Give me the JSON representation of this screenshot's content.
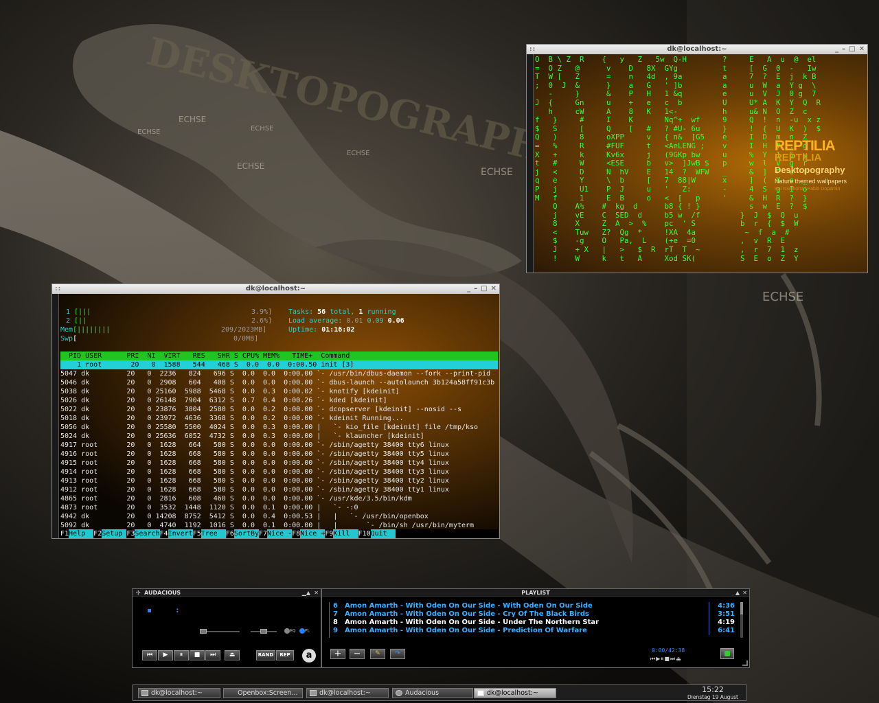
{
  "colors": {
    "term_green": "#36ff3a",
    "htop_cyan": "#2ad0d0",
    "htop_header": "#21c521",
    "playlist_blue": "#3ab0ff",
    "accent_orange": "#ffb21f"
  },
  "wallpaper": {
    "words": [
      "ECHSE",
      "ECHSE",
      "ECHSE",
      "ECHSE",
      "ECHSE",
      "ECHSE",
      "ECHSE"
    ],
    "title_art": "DESKTOPOGRAPHY"
  },
  "matrix_window": {
    "title": "dk@localhost:~",
    "lines": [
      "O  B \\ Z  R    {   y   Z   5w  Q-H        ?     E   A  u  @  el",
      "=  O Z   @      v    D   8X  GYg          t     [  G  0  -   Iw",
      "T  W [   Z      =    n   4d  , 9a         a     7  ?  E  j  k B",
      ";  0  J  &      }    a   G   ' ]b         a     u  W  a  Y g  \\",
      "   -     }      &    P   H   1 &q         e     u  V  J  0 g  7",
      "J  {     Gn     u    +   e   c  b         U     U* A  K  Y  Q  R",
      "   h     cW     A    8   K   1<-          h     u& N  O  Z  c",
      "f   }     #     I    K       Nq^+  wf     9     Q  !  n  -u  x z",
      "$   S     [     Q    [   #   ? #U- 6u     }     !  {  U  K  )  $",
      "Q   )     8     oXPP     v   { n&  [G5    e     I  D  m  n  Z",
      "=   %     R     #FUF     t   <AeLENG ;    v     I  H  #  :  g",
      "X   +     k     Kv6x     j   (9GKp bw     u     %  Y  1  6  y",
      "t   #     W     <ESE     b   v>  ]JwB $   p     w  l  V  g  r",
      "j   <     D     N  hV    E   14  ?  WFW   _     &  ]  P  u  f",
      "q   e     Y     \\  b     [   7  88|W      x     ]  (  X  o  _",
      "P   j     U1    P  J     u   '   Z:       -     4  S  g  I  o",
      "M   f     1     E  B     o   <  [   p     '     &  H  R  ?  }",
      "    Q    A%    #  kg  d      b8 { ! }           s  w  E  ?  $",
      "    j    vE    C  SED  d     b5 w  /f         }  J  $  Q  u",
      "    8    X     Z  A  >  %    pc  ' S          b  r  {  $  W",
      "    <    Tuw   Z?  Qg  *     !XA  4a           ~  f  a  #",
      "    $    -g    O   Pa,  L    (+e  =0          ,  v  R  E",
      "    J    + X   |   >   $  R  rT  T  ~         ,  r  7  1  z",
      "    !    W     k   t   A     Xod SK(          S  E  o  Z  Y"
    ],
    "logo": {
      "title": "REPTILIA",
      "sub": "REPTILIA",
      "brand": "Desktopography",
      "tagline": "Nature themed wallpapers",
      "credit": "Kai Isselhorst / Fabio Dopamin"
    }
  },
  "htop_window": {
    "title": "dk@localhost:~",
    "cpu1": {
      "label": "1",
      "bar": "[|||",
      "value": "3.9%]"
    },
    "cpu2": {
      "label": "2",
      "bar": "[||",
      "value": "2.6%]"
    },
    "mem": {
      "label": "Mem",
      "bar": "[||||||||",
      "value": "209/2023MB]"
    },
    "swp": {
      "label": "Swp",
      "bar": "[",
      "value": "0/0MB]"
    },
    "tasks": {
      "label": "Tasks:",
      "total": "56",
      "total_suffix": "total,",
      "running": "1",
      "running_suffix": "running"
    },
    "load": {
      "label": "Load average:",
      "v1": "0.01",
      "v2": "0.09",
      "v3": "0.06"
    },
    "uptime": {
      "label": "Uptime:",
      "value": "01:16:02"
    },
    "header": "  PID USER      PRI  NI  VIRT   RES   SHR S CPU% MEM%   TIME+  Command",
    "selected_row": "    1 root       20   0  1588   544   468 S  0.0  0.0  0:00.50 init [3]",
    "rows": [
      "5047 dk         20   0  2236   824   696 S  0.0  0.0  0:00.00 `- /usr/bin/dbus-daemon --fork --print-pid",
      "5046 dk         20   0  2908   604   408 S  0.0  0.0  0:00.00 `- dbus-launch --autolaunch 3b124a58ff91c3b",
      "5038 dk         20   0 25160  5988  5468 S  0.0  0.3  0:00.02 `- knotify [kdeinit]",
      "5026 dk         20   0 26148  7904  6312 S  0.7  0.4  0:00.26 `- kded [kdeinit]",
      "5022 dk         20   0 23876  3804  2580 S  0.0  0.2  0:00.00 `- dcopserver [kdeinit] --nosid --s",
      "5018 dk         20   0 23972  4636  3368 S  0.0  0.2  0:00.00 `- kdeinit Running...",
      "5056 dk         20   0 25580  5500  4024 S  0.0  0.3  0:00.00 |   `- kio_file [kdeinit] file /tmp/kso",
      "5024 dk         20   0 25636  6052  4732 S  0.0  0.3  0:00.00 |   `- klauncher [kdeinit]",
      "4917 root       20   0  1628   664   580 S  0.0  0.0  0:00.00 `- /sbin/agetty 38400 tty6 linux",
      "4916 root       20   0  1628   668   580 S  0.0  0.0  0:00.00 `- /sbin/agetty 38400 tty5 linux",
      "4915 root       20   0  1628   668   580 S  0.0  0.0  0:00.00 `- /sbin/agetty 38400 tty4 linux",
      "4914 root       20   0  1628   668   580 S  0.0  0.0  0:00.00 `- /sbin/agetty 38400 tty3 linux",
      "4913 root       20   0  1628   668   580 S  0.0  0.0  0:00.00 `- /sbin/agetty 38400 tty2 linux",
      "4912 root       20   0  1628   668   580 S  0.0  0.0  0:00.00 `- /sbin/agetty 38400 tty1 linux",
      "4865 root       20   0  2816   608   460 S  0.0  0.0  0:00.00 `- /usr/kde/3.5/bin/kdm",
      "4873 root       20   0  3532  1448  1120 S  0.0  0.1  0:00.00 |   `- -:0",
      "4942 dk         20   0 14208  8752  5412 S  0.0  0.4  0:00.53 |   |   `- /usr/bin/openbox",
      "5092 dk         20   0  4740  1192  1016 S  0.0  0.1  0:00.00 |   |       `- /bin/sh /usr/bin/myterm"
    ],
    "fkeys": [
      {
        "key": "F1",
        "label": "Help  "
      },
      {
        "key": "F2",
        "label": "Setup "
      },
      {
        "key": "F3",
        "label": "Search"
      },
      {
        "key": "F4",
        "label": "Invert"
      },
      {
        "key": "F5",
        "label": "Tree  "
      },
      {
        "key": "F6",
        "label": "SortBy"
      },
      {
        "key": "F7",
        "label": "Nice -"
      },
      {
        "key": "F8",
        "label": "Nice +"
      },
      {
        "key": "F9",
        "label": "Kill  "
      },
      {
        "key": "F10",
        "label": "Quit  "
      }
    ]
  },
  "audacious": {
    "title": "AUDACIOUS",
    "eq_label": "EQ",
    "pl_label": "PL",
    "rand_label": "RAND",
    "rep_label": "REP",
    "controls": [
      "⏮",
      "▶",
      "⏸",
      "■",
      "⏭"
    ],
    "eject": "⏏",
    "playlist_title": "PLAYLIST",
    "tracks": [
      {
        "num": "6",
        "title": "Amon Amarth - With Oden On Our Side - With Oden On Our Side",
        "time": "4:36",
        "current": false
      },
      {
        "num": "7",
        "title": "Amon Amarth - With Oden On Our Side - Cry Of The Black Birds",
        "time": "3:51",
        "current": false
      },
      {
        "num": "8",
        "title": "Amon Amarth - With Oden On Our Side - Under The Northern Star",
        "time": "4:19",
        "current": true
      },
      {
        "num": "9",
        "title": "Amon Amarth - With Oden On Our Side - Prediction Of Warfare",
        "time": "6:41",
        "current": false
      }
    ],
    "playlist_time": "0:00/42:38",
    "pl_buttons": [
      "+",
      "−",
      "✎",
      "↷"
    ]
  },
  "taskbar": {
    "tasks": [
      {
        "label": "dk@localhost:~",
        "active": false
      },
      {
        "label": "Openbox:Screen...",
        "active": false
      },
      {
        "label": "dk@localhost:~",
        "active": false
      },
      {
        "label": "Audacious",
        "active": false
      },
      {
        "label": "dk@localhost:~",
        "active": true
      }
    ],
    "clock_time": "15:22",
    "clock_date": "Dienstag 19 August"
  }
}
